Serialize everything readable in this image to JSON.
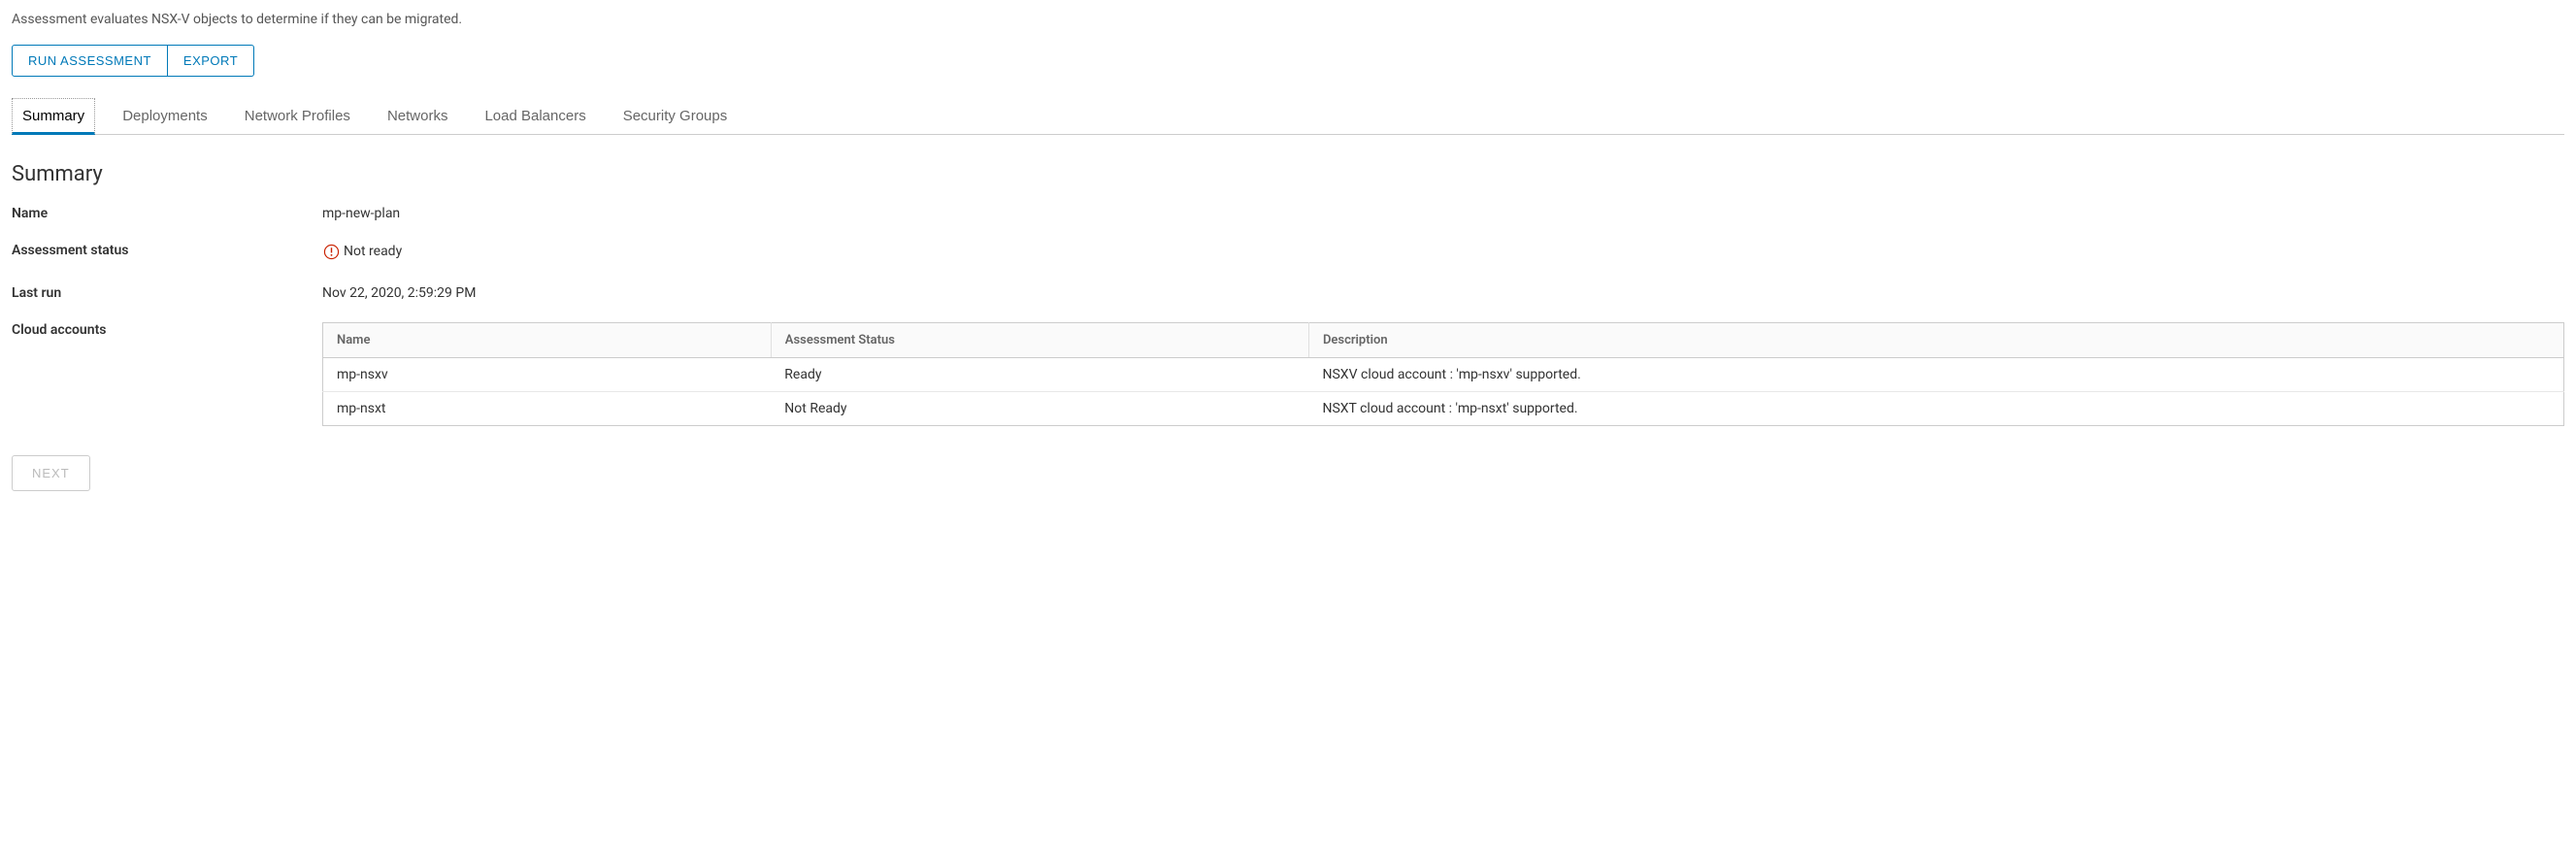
{
  "description": "Assessment evaluates NSX-V objects to determine if they can be migrated.",
  "buttons": {
    "run_assessment": "RUN ASSESSMENT",
    "export": "EXPORT",
    "next": "NEXT"
  },
  "tabs": [
    {
      "label": "Summary",
      "active": true
    },
    {
      "label": "Deployments",
      "active": false
    },
    {
      "label": "Network Profiles",
      "active": false
    },
    {
      "label": "Networks",
      "active": false
    },
    {
      "label": "Load Balancers",
      "active": false
    },
    {
      "label": "Security Groups",
      "active": false
    }
  ],
  "section_title": "Summary",
  "fields": {
    "name_label": "Name",
    "name_value": "mp-new-plan",
    "status_label": "Assessment status",
    "status_value": "Not ready",
    "last_run_label": "Last run",
    "last_run_value": "Nov 22, 2020, 2:59:29 PM",
    "cloud_accounts_label": "Cloud accounts"
  },
  "table": {
    "headers": {
      "name": "Name",
      "status": "Assessment Status",
      "description": "Description"
    },
    "rows": [
      {
        "name": "mp-nsxv",
        "status": "Ready",
        "description": "NSXV cloud account : 'mp-nsxv' supported."
      },
      {
        "name": "mp-nsxt",
        "status": "Not Ready",
        "description": "NSXT cloud account : 'mp-nsxt' supported."
      }
    ]
  }
}
